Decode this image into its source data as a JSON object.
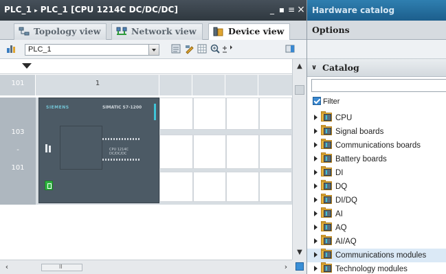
{
  "left_title": {
    "parts": [
      "PLC_1",
      "PLC_1 [CPU 1214C DC/DC/DC]"
    ],
    "separator": "▸"
  },
  "window_buttons": {
    "minimize": "_",
    "restore": "▪",
    "menu": "≡",
    "close": "×"
  },
  "view_tabs": [
    {
      "label": "Topology view",
      "icon": "topology-icon",
      "active": false
    },
    {
      "label": "Network view",
      "icon": "network-icon",
      "active": false
    },
    {
      "label": "Device view",
      "icon": "device-icon",
      "active": true
    }
  ],
  "toolbar": {
    "device_select_value": "PLC_1"
  },
  "rack": {
    "header_slots": [
      "101",
      "1"
    ],
    "row_labels": [
      "103",
      "-",
      "101"
    ]
  },
  "plc": {
    "brand": "SIEMENS",
    "model": "SIMATIC S7-1200",
    "label_lines": [
      "CPU 1214C",
      "DC/DC/DC"
    ]
  },
  "hardware_catalog": {
    "title": "Hardware catalog",
    "options_label": "Options",
    "catalog_label": "Catalog",
    "search_value": "",
    "filter_label": "Filter",
    "filter_checked": true,
    "items": [
      {
        "label": "CPU",
        "selected": false
      },
      {
        "label": "Signal boards",
        "selected": false
      },
      {
        "label": "Communications boards",
        "selected": false
      },
      {
        "label": "Battery boards",
        "selected": false
      },
      {
        "label": "DI",
        "selected": false
      },
      {
        "label": "DQ",
        "selected": false
      },
      {
        "label": "DI/DQ",
        "selected": false
      },
      {
        "label": "AI",
        "selected": false
      },
      {
        "label": "AQ",
        "selected": false
      },
      {
        "label": "AI/AQ",
        "selected": false
      },
      {
        "label": "Communications modules",
        "selected": true
      },
      {
        "label": "Technology modules",
        "selected": false
      }
    ]
  },
  "colors": {
    "title_bar": "#2f383f",
    "catalog_title_bar": "#1c5e8c",
    "rack_row": "#d7dde2",
    "plc_body": "#4c5a65",
    "plc_accent": "#3fc4d8",
    "folder": "#e7b23d",
    "selection": "#dbe9f6"
  }
}
